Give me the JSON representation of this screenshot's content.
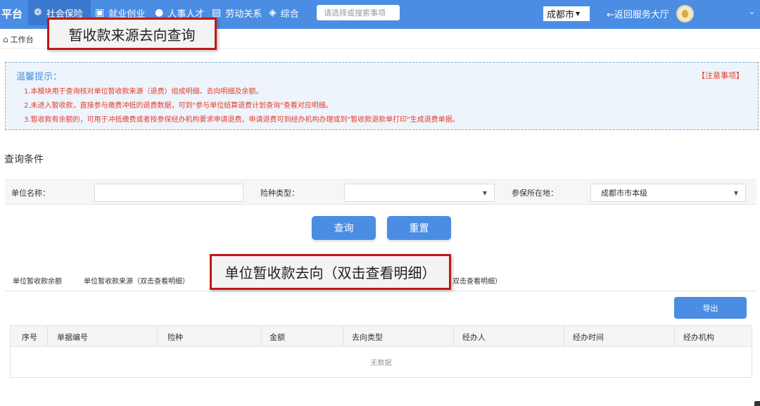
{
  "nav": {
    "brand": "平台",
    "items": [
      {
        "label": "社会保险",
        "icon": "hands-icon"
      },
      {
        "label": "就业创业",
        "icon": "briefcase-icon"
      },
      {
        "label": "人事人才",
        "icon": "person-icon"
      },
      {
        "label": "劳动关系",
        "icon": "document-icon"
      },
      {
        "label": "综合",
        "icon": "layers-icon"
      }
    ],
    "search_placeholder": "请选择或搜索事项",
    "city": "成都市",
    "back_hall": "←返回服务大厅"
  },
  "breadcrumb": {
    "home": "工作台"
  },
  "callouts": {
    "top": "暂收款来源去向查询",
    "middle": "单位暂收款去向（双击查看明细）"
  },
  "tips": {
    "title": "温馨提示：",
    "notice": "【注意事项】",
    "lines": [
      "1.本模块用于查询核对单位暂收款来源（退费）组成明细、去向明细及余额。",
      "2.未进入暂收款，直接参与缴费冲抵的退费数据，可到\"参与单位结算退费计划查询\"查看对应明细。",
      "3.暂收款有余额的，可用于冲抵缴费或者按参保经办机构要求申请退费。申请退费可到经办机构办理或到\"暂收款退款单打印\"生成退费单据。"
    ]
  },
  "query": {
    "title": "查询条件",
    "unit_name_label": "单位名称：",
    "unit_name_value": "",
    "insurance_type_label": "险种类型：",
    "insurance_type_value": "",
    "location_label": "参保所在地：",
    "location_value": "成都市市本级",
    "search_button": "查询",
    "reset_button": "重置"
  },
  "tabs": {
    "balance": "单位暂收款余额",
    "source": "单位暂收款来源（双击查看明细）",
    "dest_partial": "双击查看明细）"
  },
  "table": {
    "export_button": "导出",
    "columns": [
      "序号",
      "单据编号",
      "险种",
      "金额",
      "去向类型",
      "经办人",
      "经办时间",
      "经办机构"
    ],
    "empty_text": "无数据"
  }
}
